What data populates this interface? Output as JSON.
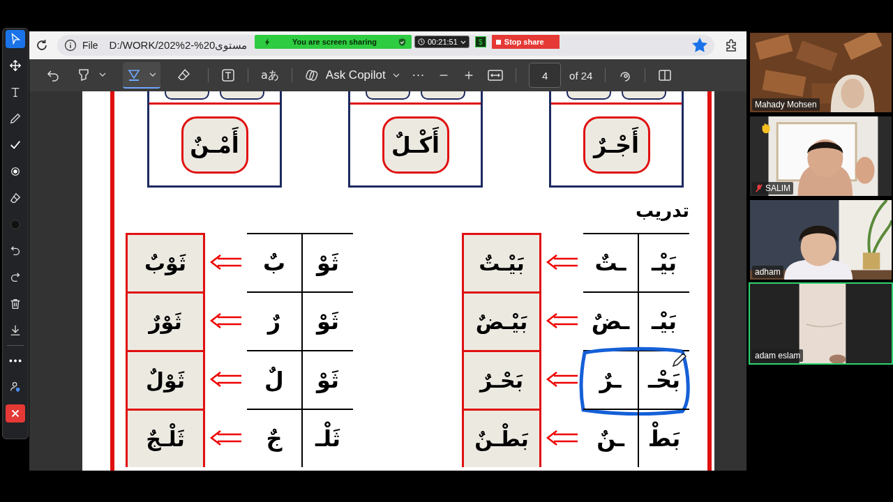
{
  "share_bar": {
    "status": "You are screen sharing",
    "timer": "00:21:51",
    "currency_sign": "$",
    "stop_label": "Stop share"
  },
  "annotation_tools": [
    {
      "kind": "select",
      "selected": true
    },
    {
      "kind": "move",
      "selected": false
    },
    {
      "kind": "text",
      "selected": false
    },
    {
      "kind": "pencil",
      "selected": false
    },
    {
      "kind": "stamp",
      "selected": false
    },
    {
      "kind": "spotlight",
      "selected": false
    },
    {
      "kind": "eraser",
      "selected": false
    },
    {
      "kind": "color",
      "selected": false
    },
    {
      "kind": "undo",
      "selected": false
    },
    {
      "kind": "redo",
      "selected": false
    },
    {
      "kind": "clear",
      "selected": false
    },
    {
      "kind": "save",
      "selected": false
    },
    {
      "kind": "more",
      "selected": false
    },
    {
      "kind": "user",
      "selected": false
    },
    {
      "kind": "close",
      "selected": false
    }
  ],
  "browser": {
    "scheme": "File",
    "url": "D:/WORK/202%مستوى20%-2",
    "bookmarked": true
  },
  "pdf_toolbar": {
    "tools": [
      {
        "kind": "highlight",
        "selected": false
      },
      {
        "kind": "draw",
        "selected": true
      },
      {
        "kind": "erase",
        "selected": false
      }
    ],
    "translate_label": "aあ",
    "copilot_label": "Ask Copilot",
    "more_label": "···",
    "page": "4",
    "page_count": "of 24"
  },
  "page": {
    "cards": [
      {
        "word": "أَجْـرٌ"
      },
      {
        "word": "أَكْـلٌ"
      },
      {
        "word": "أَمْـنٌ"
      }
    ],
    "exercise_title": "تدريب",
    "tables": [
      {
        "rows": [
          {
            "first": "بَيْـ",
            "second": "ـتٌ",
            "word": "بَيْـتٌ",
            "circled": false
          },
          {
            "first": "بَيْـ",
            "second": "ـضٌ",
            "word": "بَيْـضٌ",
            "circled": false
          },
          {
            "first": "بَحْـ",
            "second": "ـرٌ",
            "word": "بَحْـرٌ",
            "circled": true
          },
          {
            "first": "بَطْ",
            "second": "ـنٌ",
            "word": "بَطْـنٌ",
            "circled": false
          }
        ]
      },
      {
        "rows": [
          {
            "first": "ثَوْ",
            "second": "بٌ",
            "word": "ثَوْبٌ",
            "circled": false
          },
          {
            "first": "ثَوْ",
            "second": "رٌ",
            "word": "ثَوْرٌ",
            "circled": false
          },
          {
            "first": "ثَوْ",
            "second": "لٌ",
            "word": "ثَوْلٌ",
            "circled": false
          },
          {
            "first": "ثَلْـ",
            "second": "جٌ",
            "word": "ثَلْـجٌ",
            "circled": false
          }
        ]
      }
    ]
  },
  "participants": [
    {
      "name": "Mahady Mohsen",
      "muted": false,
      "hand_raised": false,
      "speaking": false
    },
    {
      "name": "SALIM",
      "muted": true,
      "hand_raised": true,
      "speaking": false
    },
    {
      "name": "adham",
      "muted": false,
      "hand_raised": false,
      "speaking": false
    },
    {
      "name": "adam eslam",
      "muted": false,
      "hand_raised": false,
      "speaking": true
    }
  ]
}
